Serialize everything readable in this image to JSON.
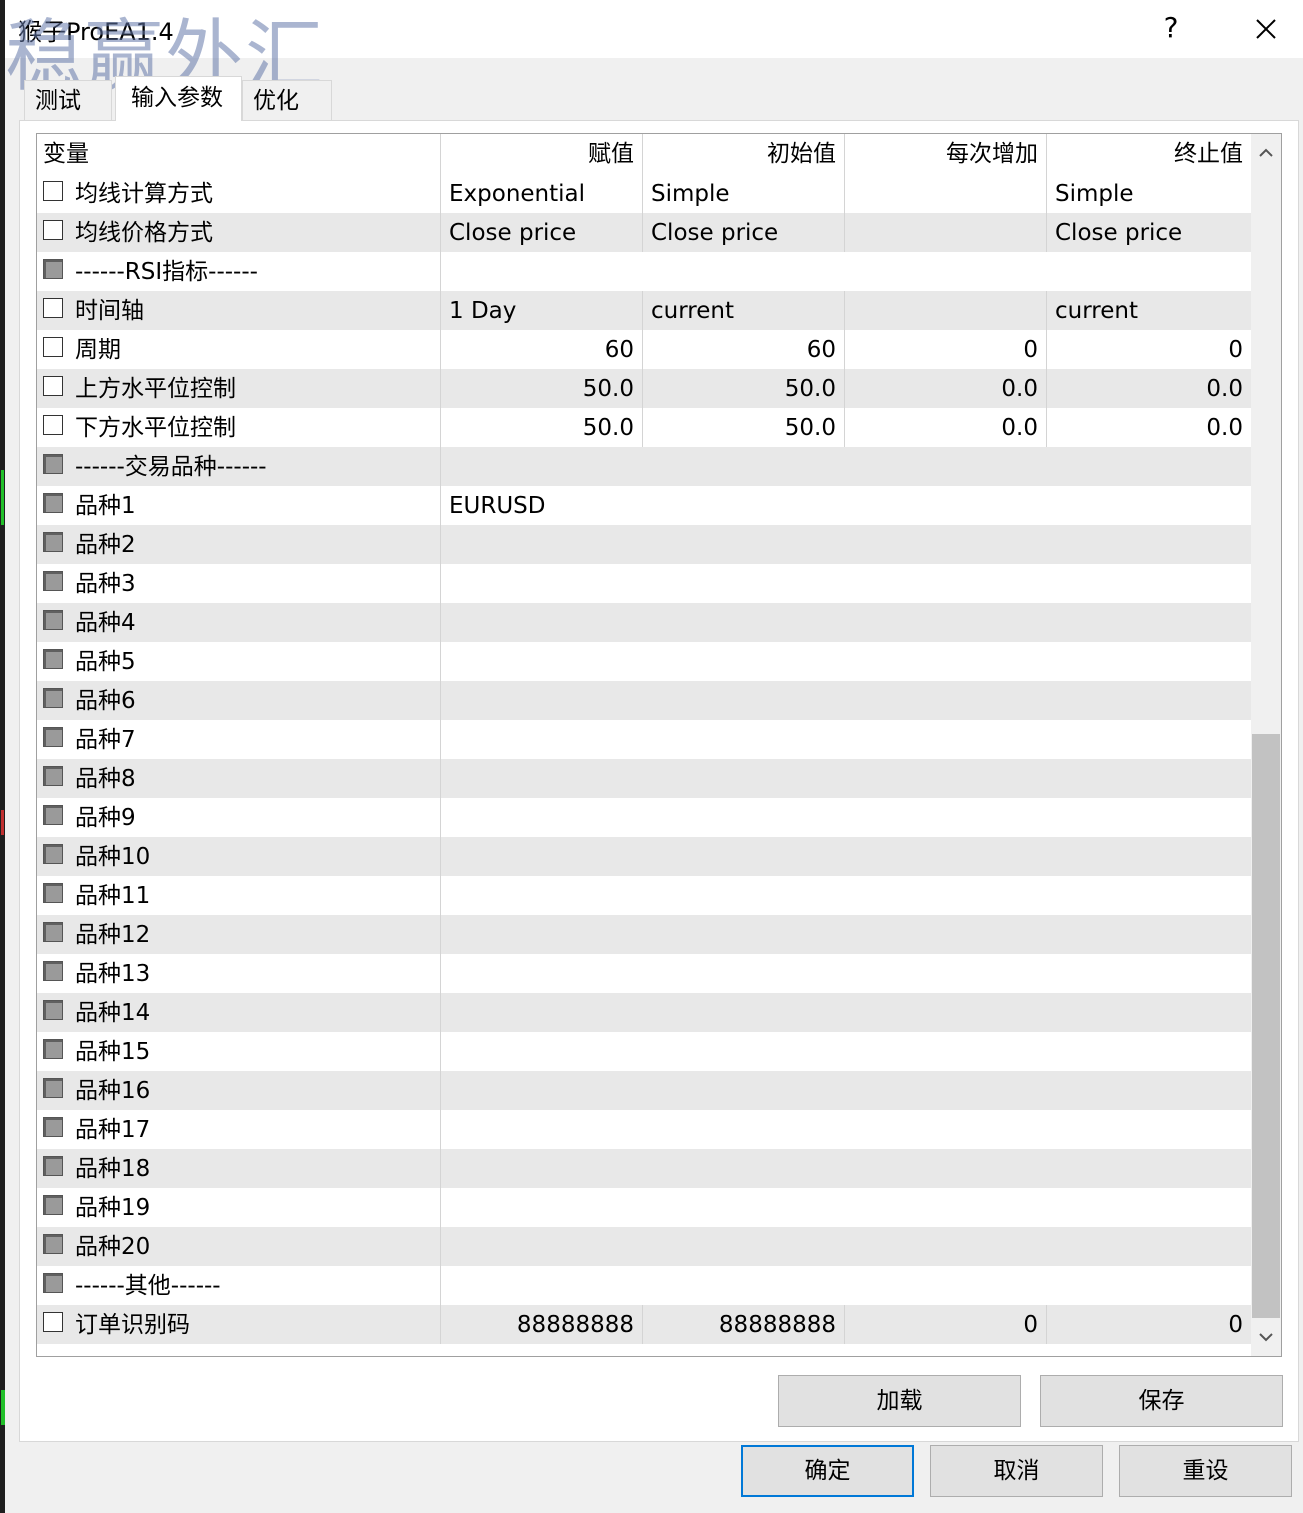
{
  "window": {
    "title": "猴子ProEA1.4",
    "watermark": "稳赢外汇",
    "help_label": "?"
  },
  "tabs": [
    {
      "label": "测试"
    },
    {
      "label": "输入参数"
    },
    {
      "label": "优化"
    }
  ],
  "table": {
    "headers": [
      "变量",
      "赋值",
      "初始值",
      "每次增加",
      "终止值"
    ],
    "rows": [
      {
        "name": "均线计算方式",
        "value": "Exponential",
        "start": "Simple",
        "step": "",
        "stop": "Simple"
      },
      {
        "name": "均线价格方式",
        "value": "Close price",
        "start": "Close price",
        "step": "",
        "stop": "Close price"
      },
      {
        "name": "------RSI指标------"
      },
      {
        "name": "时间轴",
        "value": "1 Day",
        "start": "current",
        "step": "",
        "stop": "current"
      },
      {
        "name": "周期",
        "value": "60",
        "start": "60",
        "step": "0",
        "stop": "0"
      },
      {
        "name": "上方水平位控制",
        "value": "50.0",
        "start": "50.0",
        "step": "0.0",
        "stop": "0.0"
      },
      {
        "name": "下方水平位控制",
        "value": "50.0",
        "start": "50.0",
        "step": "0.0",
        "stop": "0.0"
      },
      {
        "name": "------交易品种------"
      },
      {
        "name": "品种1",
        "value": "EURUSD"
      },
      {
        "name": "品种2",
        "value": ""
      },
      {
        "name": "品种3",
        "value": ""
      },
      {
        "name": "品种4",
        "value": ""
      },
      {
        "name": "品种5",
        "value": ""
      },
      {
        "name": "品种6",
        "value": ""
      },
      {
        "name": "品种7",
        "value": ""
      },
      {
        "name": "品种8",
        "value": ""
      },
      {
        "name": "品种9",
        "value": ""
      },
      {
        "name": "品种10",
        "value": ""
      },
      {
        "name": "品种11",
        "value": ""
      },
      {
        "name": "品种12",
        "value": ""
      },
      {
        "name": "品种13",
        "value": ""
      },
      {
        "name": "品种14",
        "value": ""
      },
      {
        "name": "品种15",
        "value": ""
      },
      {
        "name": "品种16",
        "value": ""
      },
      {
        "name": "品种17",
        "value": ""
      },
      {
        "name": "品种18",
        "value": ""
      },
      {
        "name": "品种19",
        "value": ""
      },
      {
        "name": "品种20",
        "value": ""
      },
      {
        "name": "------其他------"
      },
      {
        "name": "订单识别码",
        "value": "88888888",
        "start": "88888888",
        "step": "0",
        "stop": "0"
      }
    ]
  },
  "buttons": {
    "load": "加载",
    "save": "保存",
    "ok": "确定",
    "cancel": "取消",
    "reset": "重设"
  }
}
